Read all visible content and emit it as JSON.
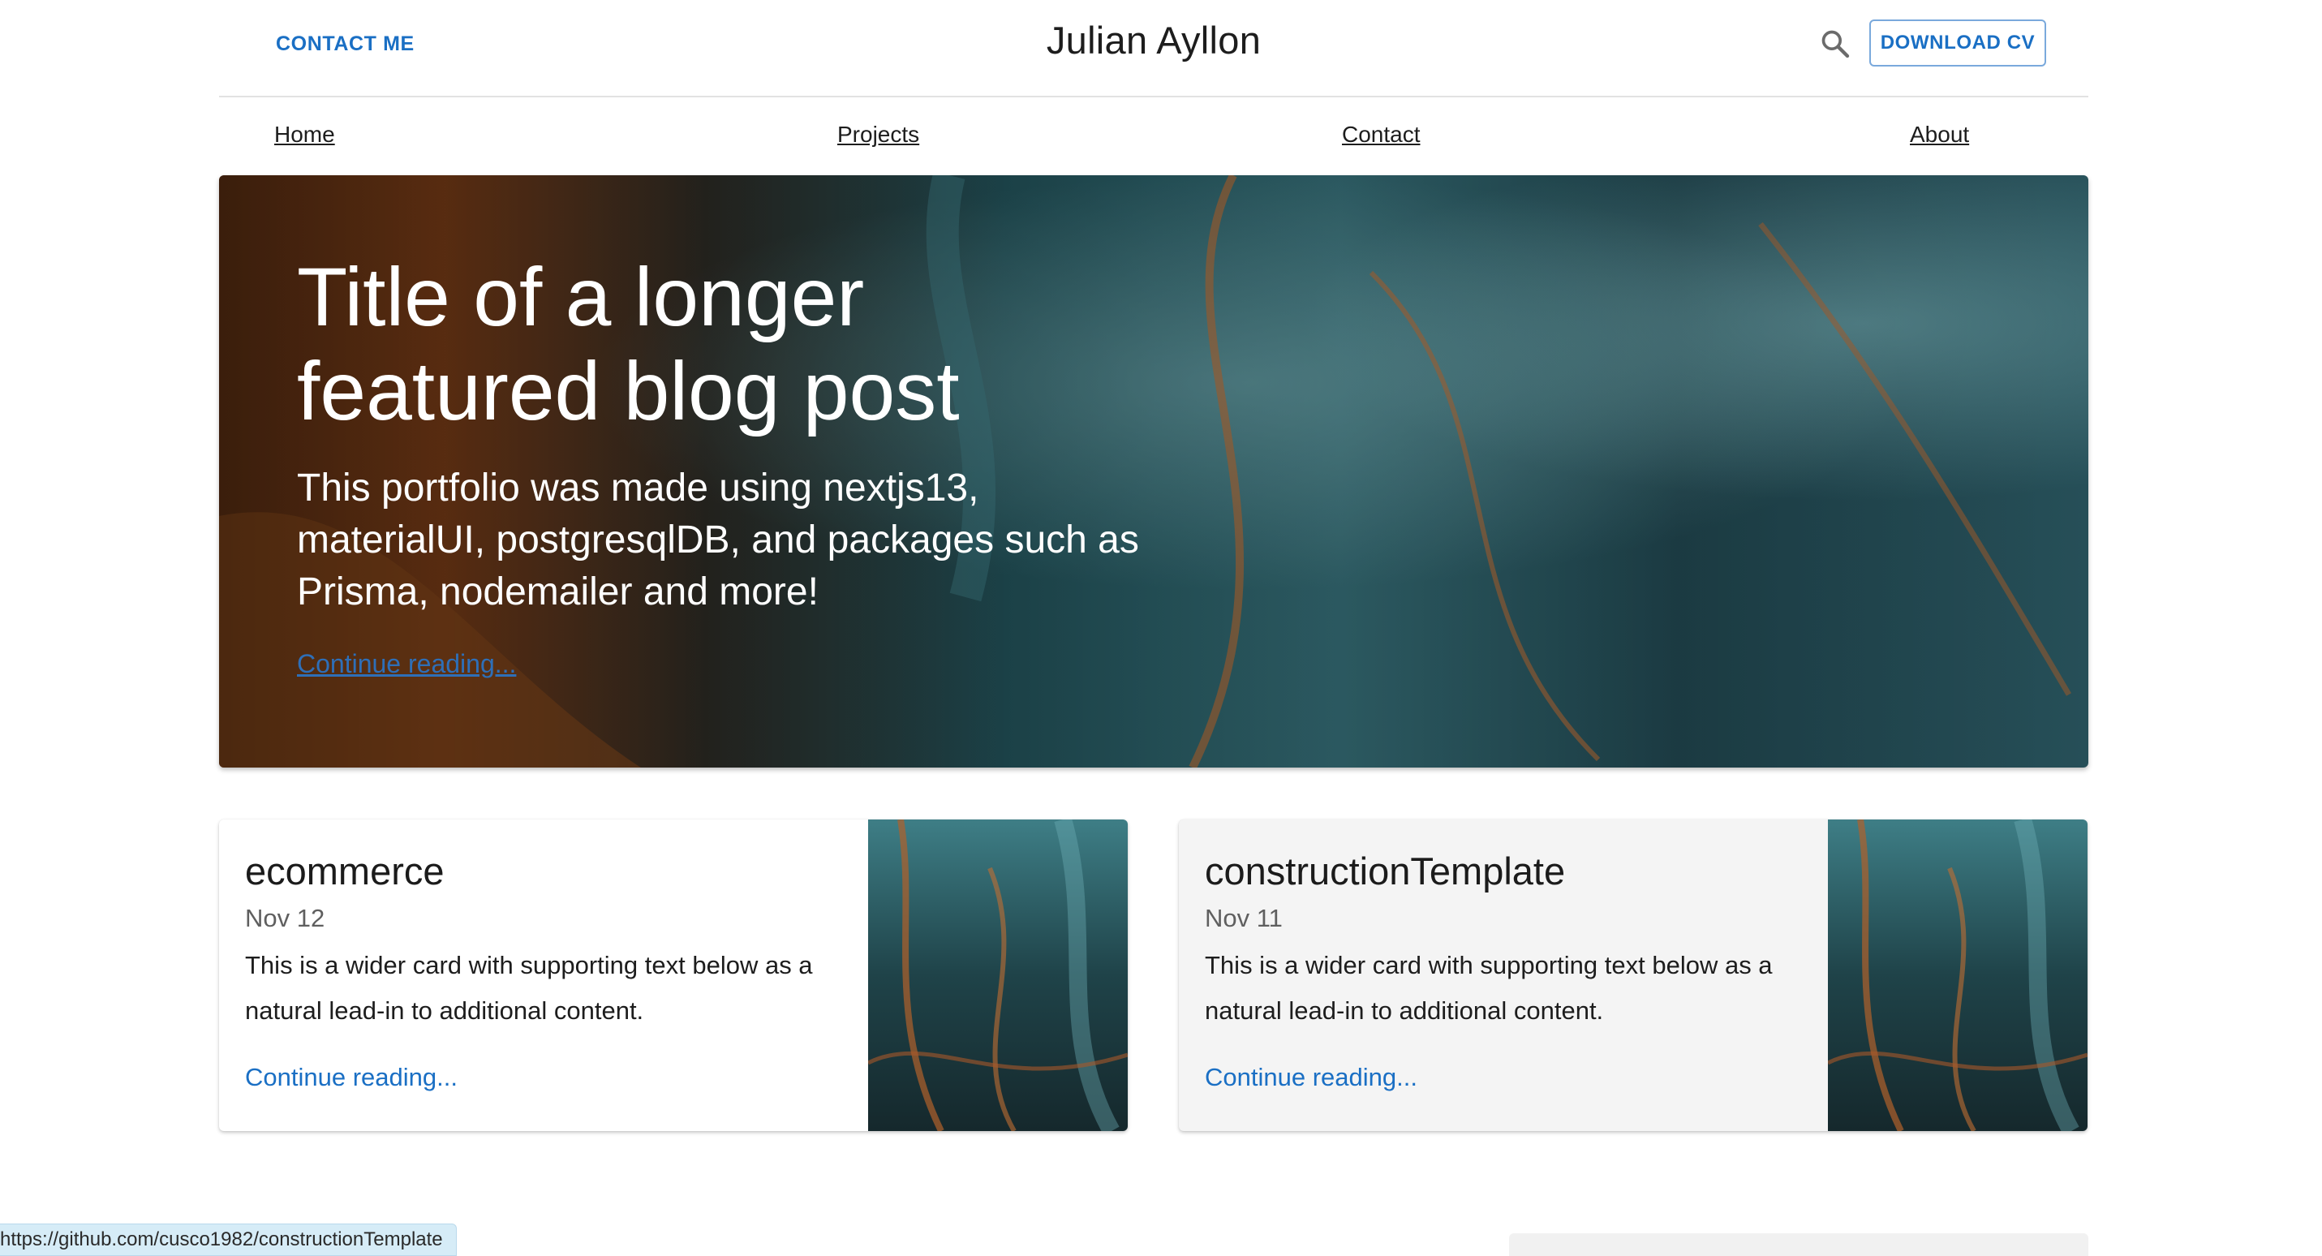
{
  "header": {
    "contact_label": "Contact me",
    "site_title": "Julian Ayllon",
    "search_icon": "search-icon",
    "download_label": "Download CV"
  },
  "nav": {
    "items": [
      {
        "label": "Home"
      },
      {
        "label": "Projects"
      },
      {
        "label": "Contact"
      },
      {
        "label": "About"
      }
    ]
  },
  "hero": {
    "title": "Title of a longer featured blog post",
    "description": "This portfolio was made using nextjs13, materialUI, postgresqlDB, and packages such as Prisma, nodemailer and more!",
    "link_label": "Continue reading..."
  },
  "cards": [
    {
      "title": "ecommerce",
      "date": "Nov 12",
      "text": "This is a wider card with supporting text below as a natural lead-in to additional content.",
      "link_label": "Continue reading..."
    },
    {
      "title": "constructionTemplate",
      "date": "Nov 11",
      "text": "This is a wider card with supporting text below as a natural lead-in to additional content.",
      "link_label": "Continue reading..."
    }
  ],
  "status_bar": {
    "url": "https://github.com/cusco1982/constructionTemplate"
  },
  "colors": {
    "accent": "#1a6fc4",
    "hero_link": "#2e6fb8",
    "status_bar_bg": "#d6ecf7"
  }
}
